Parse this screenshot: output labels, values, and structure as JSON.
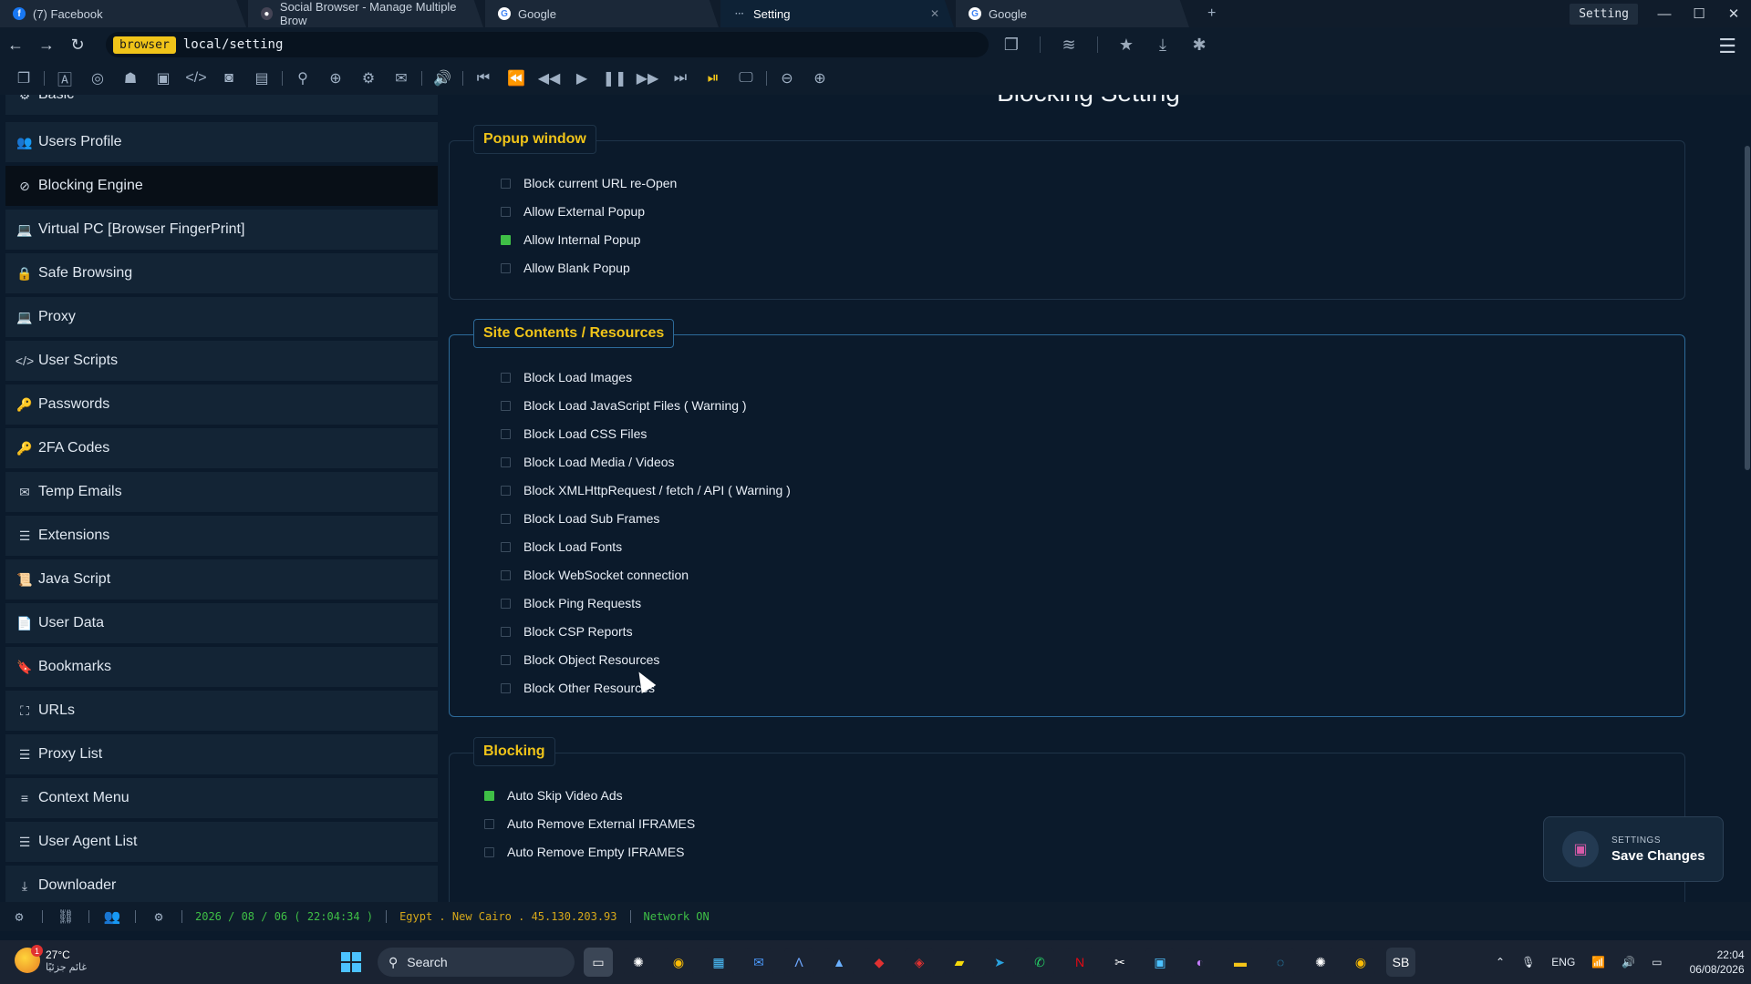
{
  "tabs": [
    {
      "title": "(7) Facebook",
      "icon": "facebook-icon",
      "active": false
    },
    {
      "title": "Social Browser - Manage Multiple Brow",
      "icon": "social-browser-icon",
      "active": false
    },
    {
      "title": "Google",
      "icon": "google-icon",
      "active": false
    },
    {
      "title": "Setting",
      "icon": "loading-dots-icon",
      "active": true
    },
    {
      "title": "Google",
      "icon": "google-icon",
      "active": false
    }
  ],
  "window": {
    "title": "Setting"
  },
  "address": {
    "tag": "browser",
    "url": "local/setting"
  },
  "sidebar": {
    "items": [
      {
        "label": "Basic",
        "icon": "gear-icon"
      },
      {
        "label": "Users Profile",
        "icon": "users-icon"
      },
      {
        "label": "Blocking Engine",
        "icon": "ban-icon"
      },
      {
        "label": "Virtual PC [Browser FingerPrint]",
        "icon": "laptop-icon"
      },
      {
        "label": "Safe Browsing",
        "icon": "lock-icon"
      },
      {
        "label": "Proxy",
        "icon": "laptop-icon"
      },
      {
        "label": "User Scripts",
        "icon": "code-icon"
      },
      {
        "label": "Passwords",
        "icon": "key-icon"
      },
      {
        "label": "2FA Codes",
        "icon": "key-icon"
      },
      {
        "label": "Temp Emails",
        "icon": "envelope-icon"
      },
      {
        "label": "Extensions",
        "icon": "list-icon"
      },
      {
        "label": "Java Script",
        "icon": "scroll-icon"
      },
      {
        "label": "User Data",
        "icon": "file-icon"
      },
      {
        "label": "Bookmarks",
        "icon": "bookmark-icon"
      },
      {
        "label": "URLs",
        "icon": "sitemap-icon"
      },
      {
        "label": "Proxy List",
        "icon": "list-icon"
      },
      {
        "label": "Context Menu",
        "icon": "menu-icon"
      },
      {
        "label": "User Agent List",
        "icon": "list-icon"
      },
      {
        "label": "Downloader",
        "icon": "download-icon"
      }
    ]
  },
  "main": {
    "page_title": "Blocking Setting",
    "groups": [
      {
        "label": "Popup window",
        "options": [
          {
            "label": "Block current URL re-Open",
            "checked": false
          },
          {
            "label": "Allow External Popup",
            "checked": false
          },
          {
            "label": "Allow Internal Popup",
            "checked": true
          },
          {
            "label": "Allow Blank Popup",
            "checked": false
          }
        ]
      },
      {
        "label": "Site Contents / Resources",
        "options": [
          {
            "label": "Block Load Images",
            "checked": false
          },
          {
            "label": "Block Load JavaScript Files ( Warning )",
            "checked": false
          },
          {
            "label": "Block Load CSS Files",
            "checked": false
          },
          {
            "label": "Block Load Media / Videos",
            "checked": false
          },
          {
            "label": "Block XMLHttpRequest / fetch / API ( Warning )",
            "checked": false
          },
          {
            "label": "Block Load Sub Frames",
            "checked": false
          },
          {
            "label": "Block Load Fonts",
            "checked": false
          },
          {
            "label": "Block WebSocket connection",
            "checked": false
          },
          {
            "label": "Block Ping Requests",
            "checked": false
          },
          {
            "label": "Block CSP Reports",
            "checked": false
          },
          {
            "label": "Block Object Resources",
            "checked": false
          },
          {
            "label": "Block Other Resources",
            "checked": false
          }
        ]
      },
      {
        "label": "Blocking",
        "options": [
          {
            "label": "Auto Skip Video Ads",
            "checked": true
          },
          {
            "label": "Auto Remove External IFRAMES",
            "checked": false
          },
          {
            "label": "Auto Remove Empty IFRAMES",
            "checked": false
          }
        ]
      }
    ]
  },
  "toast": {
    "small": "SETTINGS",
    "big": "Save Changes"
  },
  "statusbar": {
    "datetime": "2026 / 08 / 06 ( 22:04:34 )",
    "location": "Egypt . New Cairo . 45.130.203.93",
    "network": "Network ON"
  },
  "taskbar": {
    "weather_temp": "27°C",
    "weather_cond": "غائم جزئيًا",
    "weather_badge": "1",
    "search_placeholder": "Search",
    "lang": "ENG",
    "time": "22:04",
    "date": "06/08/2026"
  }
}
